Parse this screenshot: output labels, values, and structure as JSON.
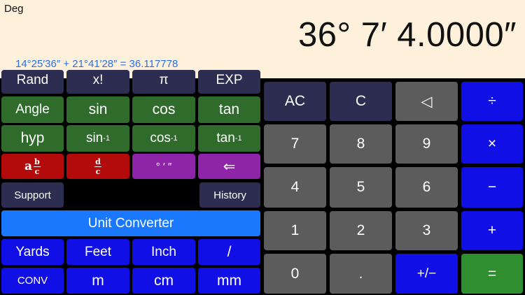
{
  "display": {
    "mode": "Deg",
    "result": "36° 7′ 4.0000″",
    "expression": "14°25′36″ + 21°41′28″ = 36.117778"
  },
  "scientific": {
    "rand": "Rand",
    "factorial": "x!",
    "pi": "π",
    "exp": "EXP",
    "angle": "Angle",
    "sin": "sin",
    "cos": "cos",
    "tan": "tan",
    "hyp": "hyp",
    "asin_base": "sin",
    "acos_base": "cos",
    "atan_base": "tan",
    "inverse_sup": "-1",
    "mixed_frac_lead": "a",
    "frac_num_b": "b",
    "frac_den_c": "c",
    "frac_num_d": "d",
    "dms": "° ′ ″",
    "back_arrow": "⇐"
  },
  "utility": {
    "support": "Support",
    "history": "History",
    "unit_converter": "Unit Converter"
  },
  "units": {
    "yards": "Yards",
    "feet": "Feet",
    "inch": "Inch",
    "slash": "/",
    "conv": "CONV",
    "m": "m",
    "cm": "cm",
    "mm": "mm"
  },
  "keypad": {
    "ac": "AC",
    "c": "C",
    "backspace": "◁",
    "divide": "÷",
    "multiply": "×",
    "minus": "−",
    "plus": "+",
    "plus_minus": "+/−",
    "equals": "=",
    "decimal": ".",
    "d0": "0",
    "d1": "1",
    "d2": "2",
    "d3": "3",
    "d4": "4",
    "d5": "5",
    "d6": "6",
    "d7": "7",
    "d8": "8",
    "d9": "9"
  }
}
